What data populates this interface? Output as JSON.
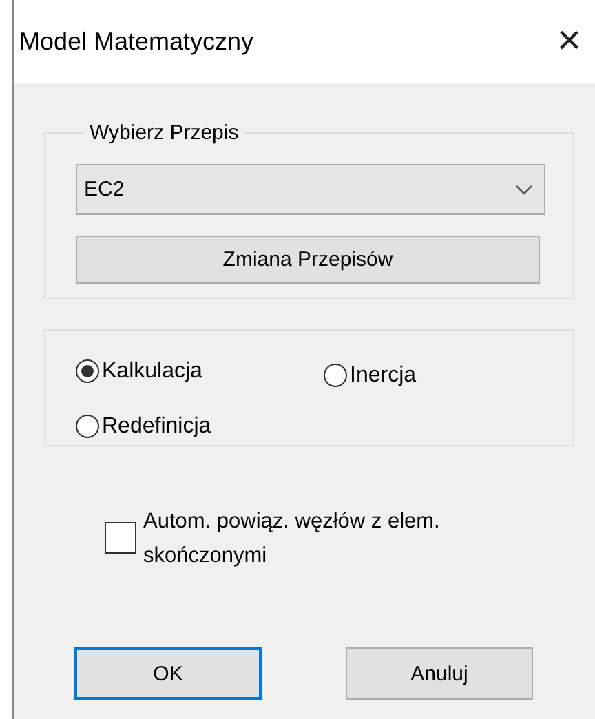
{
  "window": {
    "title": "Model Matematyczny",
    "close": "×"
  },
  "rule_group": {
    "legend": "Wybierz Przepis",
    "dropdown": {
      "value": "EC2"
    },
    "button": "Zmiana Przepisów"
  },
  "mode_options": [
    {
      "label": "Kalkulacja",
      "selected": true
    },
    {
      "label": "Inercja",
      "selected": false
    },
    {
      "label": "Redefinicja",
      "selected": false
    }
  ],
  "auto_link": {
    "label": "Autom. powiąz. węzłów z elem. skończonymi",
    "checked": false
  },
  "buttons": [
    {
      "label": "OK",
      "default": true
    },
    {
      "label": "Anuluj",
      "default": false
    }
  ]
}
